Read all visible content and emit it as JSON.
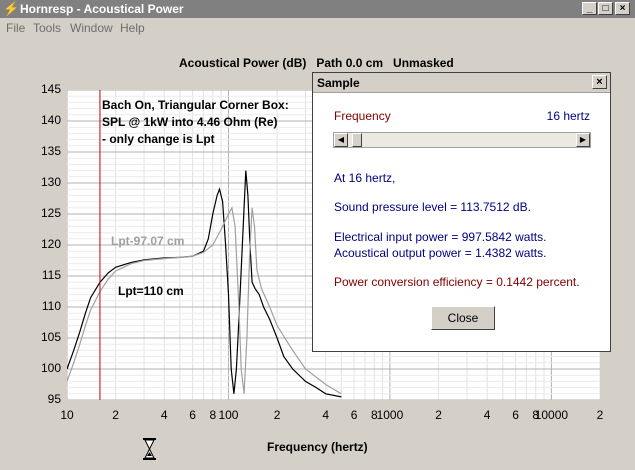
{
  "window": {
    "title": "Hornresp - Acoustical Power",
    "minimize": "_",
    "maximize": "□",
    "close": "×"
  },
  "menu": [
    "File",
    "Tools",
    "Window",
    "Help"
  ],
  "chart_header": "Acoustical Power (dB)   Path 0.0 cm   Unmasked",
  "annotations": {
    "line1": "Bach On, Triangular Corner Box:",
    "line2": "SPL @ 1kW into 4.46 Ohm (Re)",
    "line3": "- only change is Lpt",
    "grey_label": "Lpt-97.07 cm",
    "black_label": "Lpt=110 cm"
  },
  "chart_data": {
    "type": "line",
    "xlabel": "Frequency (hertz)",
    "ylabel": "",
    "x_scale": "log",
    "xlim": [
      10,
      20000
    ],
    "ylim": [
      95,
      145
    ],
    "y_ticks": [
      145,
      140,
      135,
      130,
      125,
      120,
      115,
      110,
      105,
      100,
      95
    ],
    "x_tick_labels": [
      "10",
      "2",
      "4",
      "6",
      "8",
      "100",
      "2",
      "4",
      "6",
      "8",
      "1000",
      "2",
      "4",
      "6",
      "8",
      "10000",
      "2"
    ],
    "x_tick_values": [
      10,
      20,
      40,
      60,
      80,
      100,
      200,
      400,
      600,
      800,
      1000,
      2000,
      4000,
      6000,
      8000,
      10000,
      20000
    ],
    "grid": true,
    "cursor_frequency": 16,
    "colors": {
      "series_black": "#000000",
      "series_grey": "#a0a0a0",
      "cursor": "#cc0000"
    },
    "series": [
      {
        "name": "Lpt=110 cm",
        "color": "#000000",
        "points": [
          [
            10,
            100
          ],
          [
            11,
            103
          ],
          [
            12,
            106
          ],
          [
            13,
            109
          ],
          [
            14,
            111.5
          ],
          [
            16,
            114
          ],
          [
            18,
            115.5
          ],
          [
            20,
            116.4
          ],
          [
            25,
            117.2
          ],
          [
            30,
            117.6
          ],
          [
            40,
            117.9
          ],
          [
            50,
            118
          ],
          [
            60,
            118.2
          ],
          [
            70,
            119
          ],
          [
            75,
            121
          ],
          [
            80,
            125
          ],
          [
            85,
            128
          ],
          [
            88,
            129
          ],
          [
            92,
            127
          ],
          [
            96,
            120
          ],
          [
            100,
            112
          ],
          [
            104,
            100
          ],
          [
            108,
            96
          ],
          [
            112,
            100
          ],
          [
            116,
            108
          ],
          [
            120,
            116
          ],
          [
            124,
            124
          ],
          [
            128,
            132
          ],
          [
            132,
            128
          ],
          [
            136,
            120
          ],
          [
            140,
            114
          ],
          [
            146,
            113
          ],
          [
            155,
            112
          ],
          [
            165,
            110
          ],
          [
            180,
            108
          ],
          [
            200,
            105
          ],
          [
            220,
            102
          ],
          [
            250,
            100
          ],
          [
            300,
            98
          ],
          [
            350,
            97
          ],
          [
            400,
            96
          ],
          [
            500,
            95.5
          ]
        ]
      },
      {
        "name": "Lpt-97.07 cm",
        "color": "#a0a0a0",
        "points": [
          [
            10,
            98
          ],
          [
            11,
            101
          ],
          [
            12,
            104
          ],
          [
            13,
            107
          ],
          [
            14,
            109.5
          ],
          [
            16,
            112.5
          ],
          [
            18,
            114.5
          ],
          [
            20,
            115.8
          ],
          [
            25,
            117
          ],
          [
            30,
            117.5
          ],
          [
            40,
            117.8
          ],
          [
            50,
            118
          ],
          [
            60,
            118.2
          ],
          [
            70,
            118.8
          ],
          [
            80,
            120
          ],
          [
            90,
            122.5
          ],
          [
            100,
            125
          ],
          [
            105,
            126
          ],
          [
            110,
            123
          ],
          [
            116,
            110
          ],
          [
            120,
            100
          ],
          [
            125,
            96
          ],
          [
            130,
            105
          ],
          [
            135,
            118
          ],
          [
            140,
            126
          ],
          [
            145,
            123
          ],
          [
            150,
            116
          ],
          [
            160,
            113
          ],
          [
            180,
            110
          ],
          [
            200,
            107
          ],
          [
            250,
            103
          ],
          [
            300,
            100
          ],
          [
            400,
            97.5
          ],
          [
            500,
            96
          ]
        ]
      }
    ]
  },
  "dialog": {
    "title": "Sample",
    "close_glyph": "×",
    "frequency_label": "Frequency",
    "frequency_value": "16 hertz",
    "slider_value": 0.02,
    "at_text": "At 16 hertz,",
    "spl_text": "Sound pressure level = 113.7512 dB.",
    "elec_text": "Electrical input power = 997.5842 watts.",
    "acoustic_text": "Acoustical output power = 1.4382 watts.",
    "efficiency_text": "Power conversion efficiency = 0.1442 percent.",
    "close_label": "Close"
  }
}
